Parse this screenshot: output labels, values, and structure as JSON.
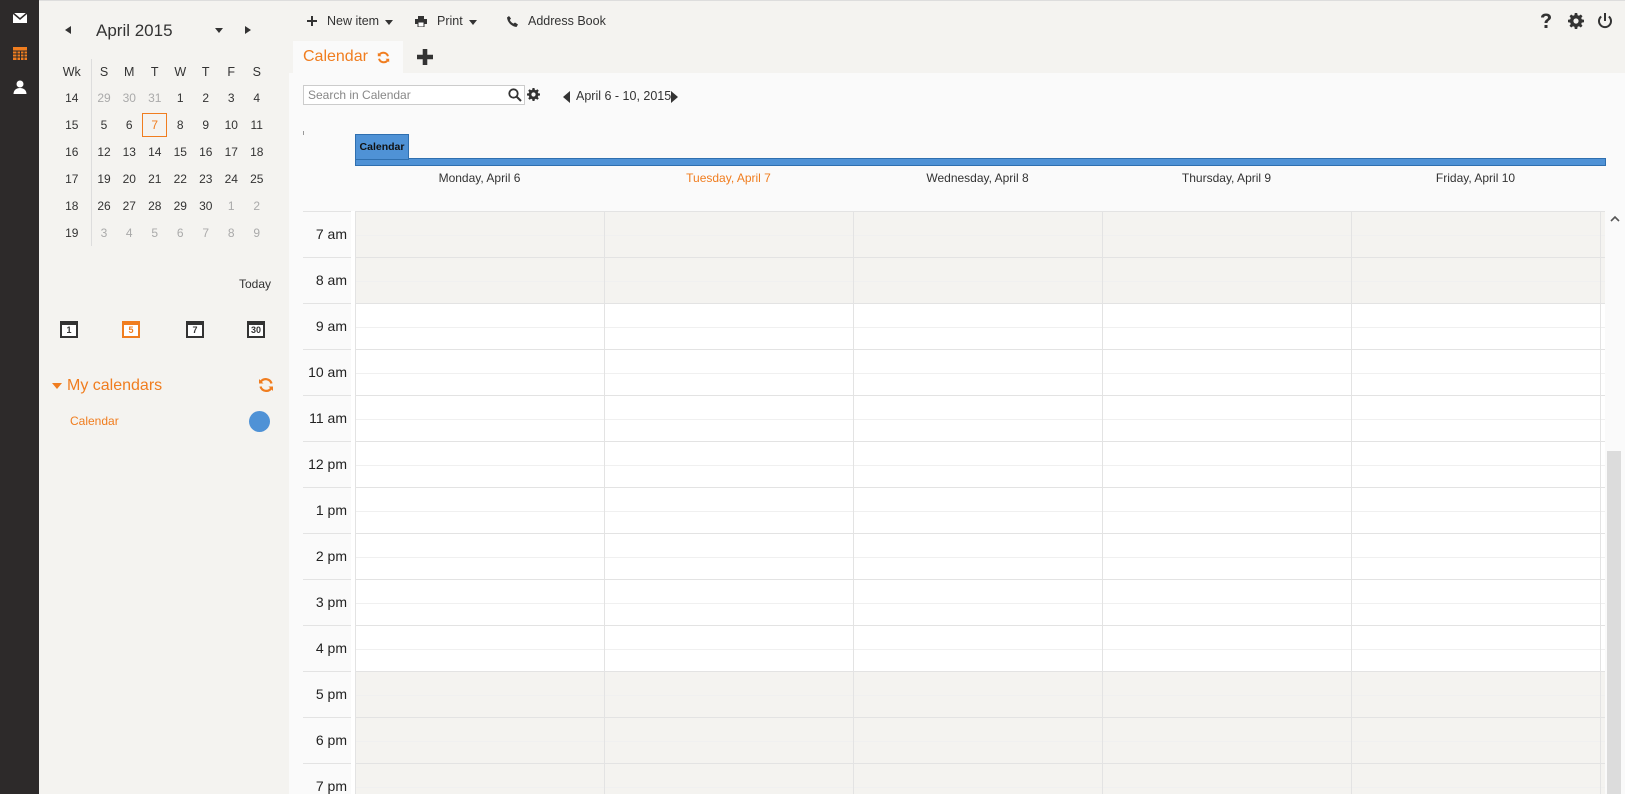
{
  "rail": {
    "items": [
      {
        "name": "mail-icon",
        "color": "#ffffff"
      },
      {
        "name": "calendar-icon",
        "color": "#f07d1f"
      },
      {
        "name": "contacts-icon",
        "color": "#ffffff"
      }
    ]
  },
  "mini_calendar": {
    "month_title": "April 2015",
    "headers": [
      "Wk",
      "S",
      "M",
      "T",
      "W",
      "T",
      "F",
      "S"
    ],
    "weeks": [
      {
        "wk": "14",
        "days": [
          {
            "d": "29",
            "o": true
          },
          {
            "d": "30",
            "o": true
          },
          {
            "d": "31",
            "o": true
          },
          {
            "d": "1"
          },
          {
            "d": "2"
          },
          {
            "d": "3"
          },
          {
            "d": "4"
          }
        ]
      },
      {
        "wk": "15",
        "days": [
          {
            "d": "5"
          },
          {
            "d": "6"
          },
          {
            "d": "7",
            "today": true
          },
          {
            "d": "8"
          },
          {
            "d": "9"
          },
          {
            "d": "10"
          },
          {
            "d": "11"
          }
        ]
      },
      {
        "wk": "16",
        "days": [
          {
            "d": "12"
          },
          {
            "d": "13"
          },
          {
            "d": "14"
          },
          {
            "d": "15"
          },
          {
            "d": "16"
          },
          {
            "d": "17"
          },
          {
            "d": "18"
          }
        ]
      },
      {
        "wk": "17",
        "days": [
          {
            "d": "19"
          },
          {
            "d": "20"
          },
          {
            "d": "21"
          },
          {
            "d": "22"
          },
          {
            "d": "23"
          },
          {
            "d": "24"
          },
          {
            "d": "25"
          }
        ]
      },
      {
        "wk": "18",
        "days": [
          {
            "d": "26"
          },
          {
            "d": "27"
          },
          {
            "d": "28"
          },
          {
            "d": "29"
          },
          {
            "d": "30"
          },
          {
            "d": "1",
            "o": true
          },
          {
            "d": "2",
            "o": true
          }
        ]
      },
      {
        "wk": "19",
        "days": [
          {
            "d": "3",
            "o": true
          },
          {
            "d": "4",
            "o": true
          },
          {
            "d": "5",
            "o": true
          },
          {
            "d": "6",
            "o": true
          },
          {
            "d": "7",
            "o": true
          },
          {
            "d": "8",
            "o": true
          },
          {
            "d": "9",
            "o": true
          }
        ]
      }
    ],
    "today_label": "Today"
  },
  "views": [
    {
      "name": "day-view-button",
      "label": "1",
      "active": false
    },
    {
      "name": "workweek-view-button",
      "label": "5",
      "active": true
    },
    {
      "name": "week-view-button",
      "label": "7",
      "active": false
    },
    {
      "name": "month-view-button",
      "label": "30",
      "active": false
    }
  ],
  "my_calendars": {
    "title": "My calendars",
    "items": [
      {
        "label": "Calendar",
        "color": "#4f92d6"
      }
    ]
  },
  "toolbar": {
    "new_item": "New item",
    "print": "Print",
    "address_book": "Address Book"
  },
  "tab": {
    "label": "Calendar"
  },
  "search": {
    "placeholder": "Search in Calendar",
    "value": ""
  },
  "range": {
    "label": "April 6 - 10, 2015"
  },
  "calendar_header": {
    "label": "Calendar",
    "days": [
      {
        "label": "Monday, April 6",
        "today": false
      },
      {
        "label": "Tuesday, April 7",
        "today": true
      },
      {
        "label": "Wednesday, April 8",
        "today": false
      },
      {
        "label": "Thursday, April 9",
        "today": false
      },
      {
        "label": "Friday, April 10",
        "today": false
      }
    ]
  },
  "hours": [
    {
      "label": "7 am",
      "off": true
    },
    {
      "label": "8 am",
      "off": true
    },
    {
      "label": "9 am",
      "off": false
    },
    {
      "label": "10 am",
      "off": false
    },
    {
      "label": "11 am",
      "off": false
    },
    {
      "label": "12 pm",
      "off": false
    },
    {
      "label": "1 pm",
      "off": false
    },
    {
      "label": "2 pm",
      "off": false
    },
    {
      "label": "3 pm",
      "off": false
    },
    {
      "label": "4 pm",
      "off": false
    },
    {
      "label": "5 pm",
      "off": true
    },
    {
      "label": "6 pm",
      "off": true
    },
    {
      "label": "7 pm",
      "off": true
    }
  ],
  "colors": {
    "accent": "#f07d1f",
    "calendar": "#4f92d6"
  }
}
